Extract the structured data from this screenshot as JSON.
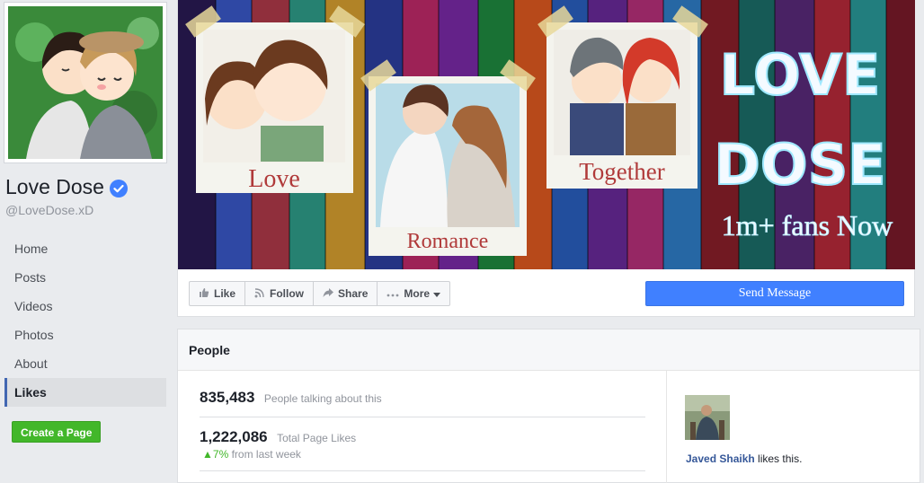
{
  "page": {
    "name": "Love Dose",
    "handle": "@LoveDose.xD"
  },
  "nav": {
    "items": [
      {
        "label": "Home"
      },
      {
        "label": "Posts"
      },
      {
        "label": "Videos"
      },
      {
        "label": "Photos"
      },
      {
        "label": "About"
      },
      {
        "label": "Likes",
        "active": true
      }
    ],
    "create_page": "Create a Page"
  },
  "cover": {
    "photo_captions": [
      "Love",
      "Romance",
      "Together"
    ],
    "title_line1": "LOVE",
    "title_line2": "DOSE",
    "fans_text": "1m+ fans Now"
  },
  "actions": {
    "like": "Like",
    "follow": "Follow",
    "share": "Share",
    "more": "More",
    "send_message": "Send Message"
  },
  "people": {
    "title": "People",
    "talking_count": "835,483",
    "talking_label": "People talking about this",
    "likes_count": "1,222,086",
    "likes_label": "Total Page Likes",
    "growth_percent": "7%",
    "growth_label": "from last week",
    "friend_name": "Javed Shaikh",
    "friend_suffix": " likes this."
  },
  "colors": {
    "brand_blue": "#4267b2",
    "send_blue": "#4080ff",
    "create_green": "#42b72a",
    "verified_blue": "#4080ff"
  },
  "icons": [
    "verified-badge-icon",
    "thumbs-up-icon",
    "rss-icon",
    "share-arrow-icon",
    "more-dots-icon",
    "caret-down-icon",
    "up-triangle-icon"
  ]
}
